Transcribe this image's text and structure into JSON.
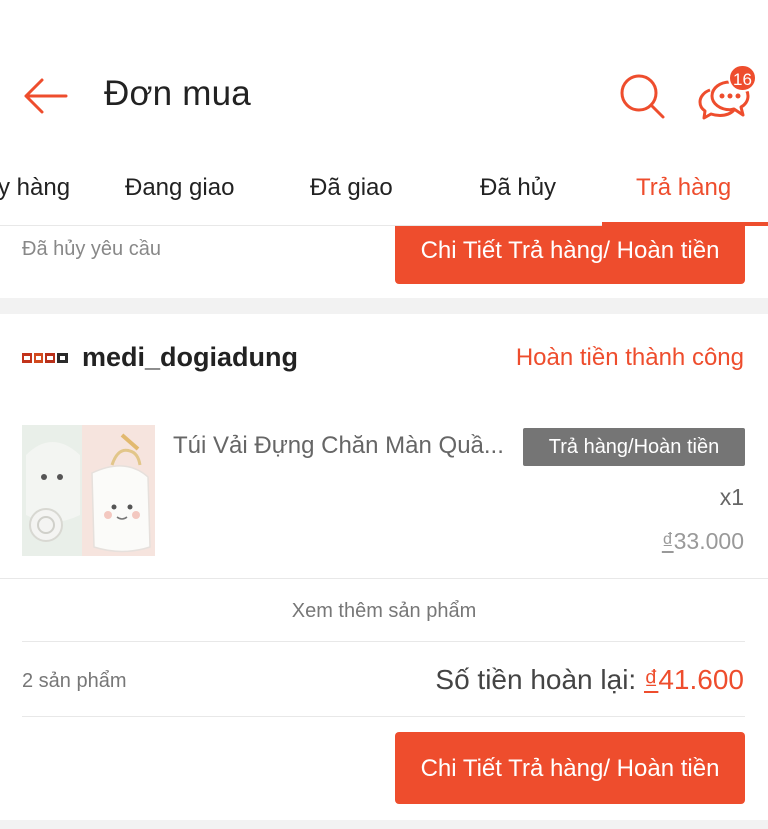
{
  "header": {
    "title": "Đơn mua",
    "chat_badge": "16"
  },
  "tabs": [
    {
      "label": "y hàng"
    },
    {
      "label": "Đang giao"
    },
    {
      "label": "Đã giao"
    },
    {
      "label": "Đã hủy"
    },
    {
      "label": "Trả hàng",
      "active": true
    }
  ],
  "previous_order": {
    "status": "Đã hủy yêu cầu",
    "detail_button": "Chi Tiết Trả hàng/ Hoàn tiền"
  },
  "order": {
    "shop_logo_text": "MEDI",
    "shop_name": "medi_dogiadung",
    "status": "Hoàn tiền thành công",
    "product": {
      "name": "Túi Vải Đựng Chăn Màn Quầ...",
      "tag": "Trả hàng/Hoàn tiền",
      "quantity": "x1",
      "currency": "₫",
      "price": "33.000"
    },
    "see_more": "Xem thêm sản phẩm",
    "product_count": "2 sản phẩm",
    "refund_label": "Số tiền hoàn lại: ",
    "refund_currency": "₫",
    "refund_amount": "41.600",
    "detail_button": "Chi Tiết Trả hàng/ Hoàn tiền"
  },
  "colors": {
    "accent": "#ee4d2d",
    "tag_bg": "#757575",
    "separator": "#f2f2f2"
  },
  "icons": [
    "back-arrow-icon",
    "search-icon",
    "chat-icon"
  ]
}
